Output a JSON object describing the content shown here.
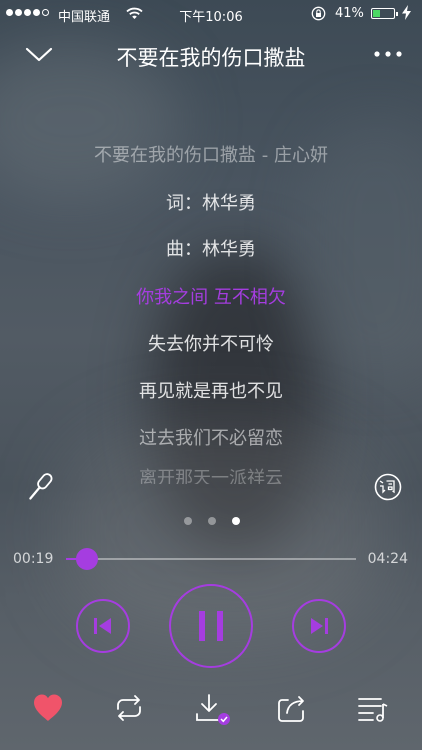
{
  "status_bar": {
    "carrier": "中国联通",
    "time": "下午10:06",
    "battery_percent": "41%",
    "battery_level": 0.41,
    "signal_bars": 4,
    "signal_max": 5
  },
  "header": {
    "title": "不要在我的伤口撒盐",
    "icons": [
      "chevron-down-icon",
      "more-icon"
    ]
  },
  "lyrics": {
    "lines": [
      "不要在我的伤口撒盐 - 庄心妍",
      "词：林华勇",
      "曲：林华勇",
      "你我之间 互不相欠",
      "失去你并不可怜",
      "再见就是再也不见",
      "过去我们不必留恋",
      "离开那天一派祥云"
    ],
    "active_index": 3
  },
  "pager": {
    "count": 3,
    "current": 3
  },
  "player": {
    "elapsed": "00:19",
    "duration": "04:24",
    "progress_fraction": 0.072,
    "accent_color": "#a53de0",
    "state": "playing"
  },
  "toolbar": {
    "icons": [
      "heart-icon",
      "repeat-icon",
      "download-icon",
      "share-icon",
      "playlist-icon"
    ],
    "liked": true,
    "like_color": "#f0546a"
  }
}
